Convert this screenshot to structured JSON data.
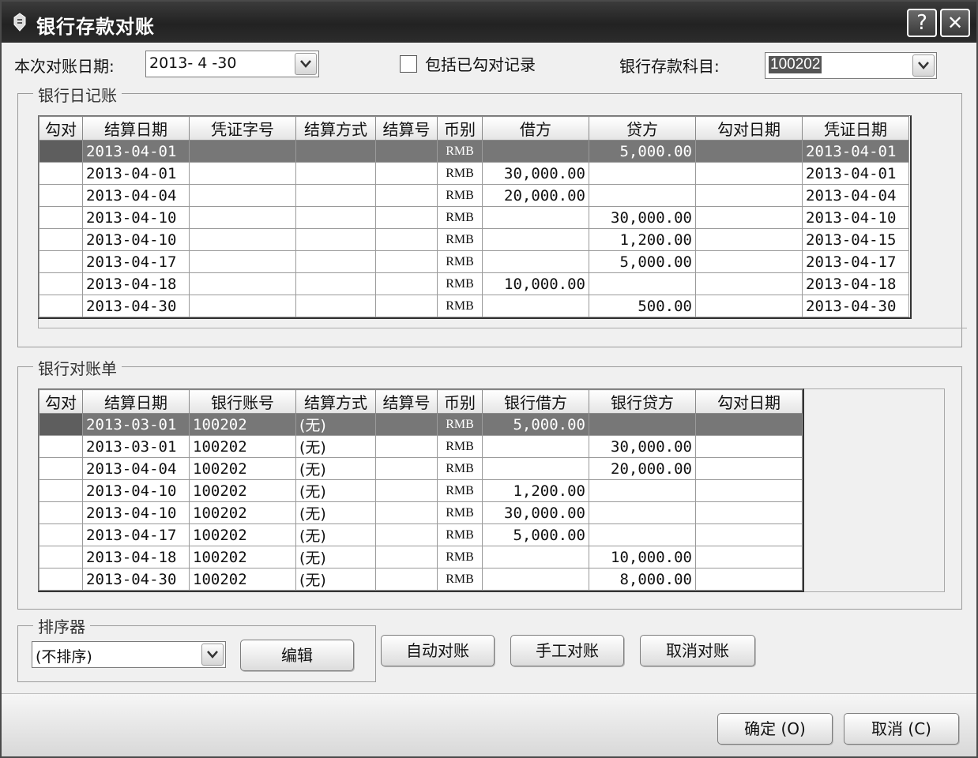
{
  "window": {
    "title": "银行存款对账",
    "help_label": "?",
    "close_label": "✕"
  },
  "filters": {
    "date_label": "本次对账日期:",
    "date_value": "2013- 4 -30",
    "include_label": "包括已勾对记录",
    "include_checked": false,
    "account_label": "银行存款科目:",
    "account_value": "100202"
  },
  "journal": {
    "title": "银行日记账",
    "columns": [
      "勾对",
      "结算日期",
      "凭证字号",
      "结算方式",
      "结算号",
      "币别",
      "借方",
      "贷方",
      "勾对日期",
      "凭证日期"
    ],
    "rows": [
      {
        "check": "",
        "date": "2013-04-01",
        "voucher": "",
        "method": "",
        "no": "",
        "currency": "RMB",
        "debit": "",
        "credit": "5,000.00",
        "match_date": "",
        "voucher_date": "2013-04-01"
      },
      {
        "check": "",
        "date": "2013-04-01",
        "voucher": "",
        "method": "",
        "no": "",
        "currency": "RMB",
        "debit": "30,000.00",
        "credit": "",
        "match_date": "",
        "voucher_date": "2013-04-01"
      },
      {
        "check": "",
        "date": "2013-04-04",
        "voucher": "",
        "method": "",
        "no": "",
        "currency": "RMB",
        "debit": "20,000.00",
        "credit": "",
        "match_date": "",
        "voucher_date": "2013-04-04"
      },
      {
        "check": "",
        "date": "2013-04-10",
        "voucher": "",
        "method": "",
        "no": "",
        "currency": "RMB",
        "debit": "",
        "credit": "30,000.00",
        "match_date": "",
        "voucher_date": "2013-04-10"
      },
      {
        "check": "",
        "date": "2013-04-10",
        "voucher": "",
        "method": "",
        "no": "",
        "currency": "RMB",
        "debit": "",
        "credit": "1,200.00",
        "match_date": "",
        "voucher_date": "2013-04-15"
      },
      {
        "check": "",
        "date": "2013-04-17",
        "voucher": "",
        "method": "",
        "no": "",
        "currency": "RMB",
        "debit": "",
        "credit": "5,000.00",
        "match_date": "",
        "voucher_date": "2013-04-17"
      },
      {
        "check": "",
        "date": "2013-04-18",
        "voucher": "",
        "method": "",
        "no": "",
        "currency": "RMB",
        "debit": "10,000.00",
        "credit": "",
        "match_date": "",
        "voucher_date": "2013-04-18"
      },
      {
        "check": "",
        "date": "2013-04-30",
        "voucher": "",
        "method": "",
        "no": "",
        "currency": "RMB",
        "debit": "",
        "credit": "500.00",
        "match_date": "",
        "voucher_date": "2013-04-30"
      }
    ]
  },
  "statement": {
    "title": "银行对账单",
    "columns": [
      "勾对",
      "结算日期",
      "银行账号",
      "结算方式",
      "结算号",
      "币别",
      "银行借方",
      "银行贷方",
      "勾对日期"
    ],
    "rows": [
      {
        "check": "",
        "date": "2013-03-01",
        "account": "100202",
        "method": "(无)",
        "no": "",
        "currency": "RMB",
        "debit": "5,000.00",
        "credit": "",
        "match_date": ""
      },
      {
        "check": "",
        "date": "2013-03-01",
        "account": "100202",
        "method": "(无)",
        "no": "",
        "currency": "RMB",
        "debit": "",
        "credit": "30,000.00",
        "match_date": ""
      },
      {
        "check": "",
        "date": "2013-04-04",
        "account": "100202",
        "method": "(无)",
        "no": "",
        "currency": "RMB",
        "debit": "",
        "credit": "20,000.00",
        "match_date": ""
      },
      {
        "check": "",
        "date": "2013-04-10",
        "account": "100202",
        "method": "(无)",
        "no": "",
        "currency": "RMB",
        "debit": "1,200.00",
        "credit": "",
        "match_date": ""
      },
      {
        "check": "",
        "date": "2013-04-10",
        "account": "100202",
        "method": "(无)",
        "no": "",
        "currency": "RMB",
        "debit": "30,000.00",
        "credit": "",
        "match_date": ""
      },
      {
        "check": "",
        "date": "2013-04-17",
        "account": "100202",
        "method": "(无)",
        "no": "",
        "currency": "RMB",
        "debit": "5,000.00",
        "credit": "",
        "match_date": ""
      },
      {
        "check": "",
        "date": "2013-04-18",
        "account": "100202",
        "method": "(无)",
        "no": "",
        "currency": "RMB",
        "debit": "",
        "credit": "10,000.00",
        "match_date": ""
      },
      {
        "check": "",
        "date": "2013-04-30",
        "account": "100202",
        "method": "(无)",
        "no": "",
        "currency": "RMB",
        "debit": "",
        "credit": "8,000.00",
        "match_date": ""
      }
    ]
  },
  "sorter": {
    "title": "排序器",
    "value": "(不排序)",
    "edit_label": "编辑"
  },
  "actions": {
    "auto_label": "自动对账",
    "manual_label": "手工对账",
    "cancel_match_label": "取消对账"
  },
  "footer": {
    "ok_label": "确定 (O)",
    "cancel_label": "取消 (C)"
  }
}
